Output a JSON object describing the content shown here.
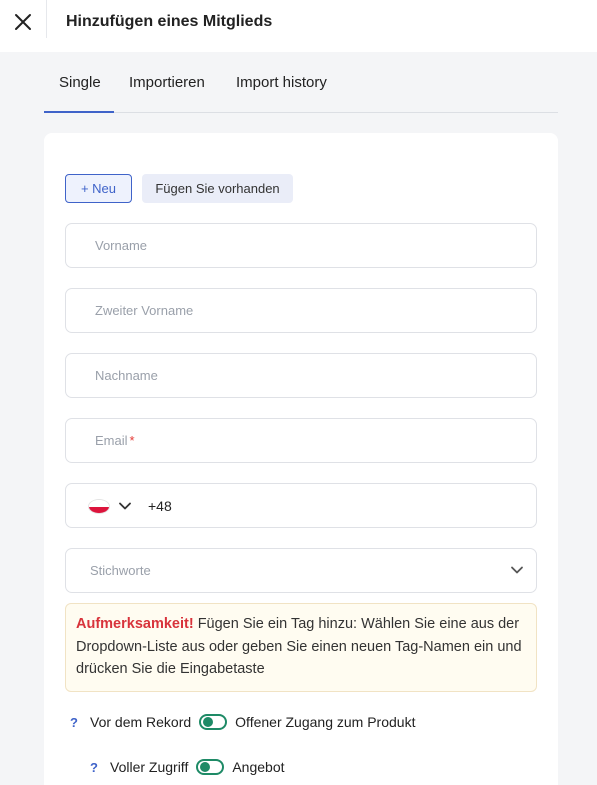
{
  "header": {
    "title": "Hinzufügen eines Mitglieds",
    "close_icon": "close-icon"
  },
  "tabs": [
    {
      "label": "Single",
      "active": true
    },
    {
      "label": "Importieren",
      "active": false
    },
    {
      "label": "Import history",
      "active": false
    }
  ],
  "form": {
    "new_label": "+ Neu",
    "existing_label": "Fügen Sie vorhanden",
    "first_name_placeholder": "Vorname",
    "middle_name_placeholder": "Zweiter Vorname",
    "last_name_placeholder": "Nachname",
    "email_placeholder": "Email",
    "required_mark": "*",
    "phone_country_code": "+48",
    "phone_flag": "poland-flag-icon",
    "tags_placeholder": "Stichworte"
  },
  "alert": {
    "title": "Aufmerksamkeit!",
    "text": " Fügen Sie ein Tag hinzu: Wählen Sie eine aus der Dropdown-Liste aus oder geben Sie einen neuen Tag-Namen ein und drücken Sie die Eingabetaste"
  },
  "options": [
    {
      "help": "?",
      "label": "Vor dem Rekord",
      "toggle_label": "Offener Zugang zum Produkt",
      "toggle_on": true
    },
    {
      "help": "?",
      "label": "Voller Zugriff",
      "toggle_label": "Angebot",
      "toggle_on": true
    }
  ],
  "colors": {
    "accent": "#3f63c9",
    "toggle": "#1e8a66",
    "alert_title": "#d8333b"
  }
}
